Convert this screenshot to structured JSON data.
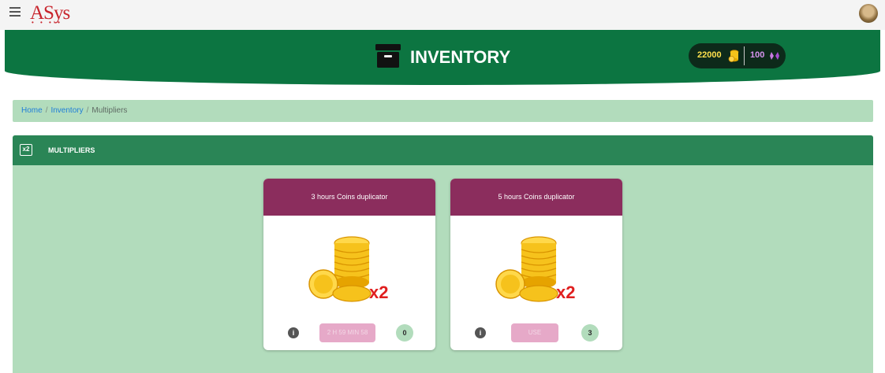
{
  "app": {
    "logo_text": "ASys",
    "logo_dots": "• • • •"
  },
  "header": {
    "title": "INVENTORY",
    "coins": "22000",
    "gems": "100",
    "icon": "inventory-box-icon"
  },
  "breadcrumb": {
    "home": "Home",
    "sep": "/",
    "inventory": "Inventory",
    "current": "Multipliers"
  },
  "panel": {
    "badge": "x2",
    "title": "MULTIPLIERS"
  },
  "cards": [
    {
      "title": "3 hours Coins duplicator",
      "multiplier": "x2",
      "action_label": "2 H 59 MIN 58",
      "count": "0"
    },
    {
      "title": "5 hours Coins duplicator",
      "multiplier": "x2",
      "action_label": "USE",
      "count": "3"
    }
  ],
  "colors": {
    "header_green": "#0c7541",
    "panel_bg": "#b2dcbc",
    "card_header": "#8b2d5d",
    "button_pink": "#e6a9c8",
    "logo_red": "#c8242c"
  },
  "icons": {
    "menu": "hamburger-menu-icon",
    "coin": "coin-icon",
    "gem": "gem-icon",
    "info": "info-icon",
    "user": "avatar"
  }
}
